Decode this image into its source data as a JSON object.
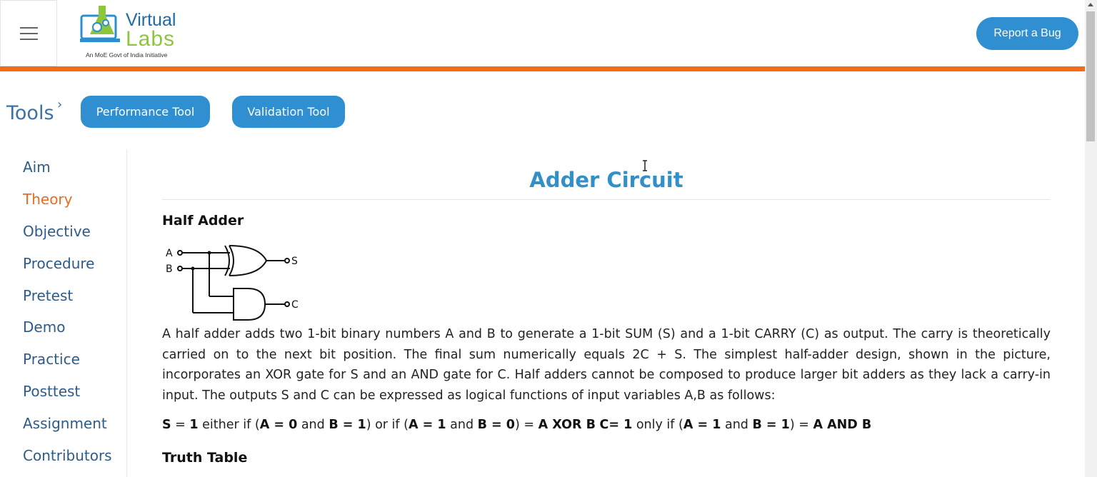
{
  "header": {
    "logo": {
      "title_part1": "Virtual",
      "title_part2": "Labs",
      "tagline": "An MoE Govt of India Initiative"
    },
    "report_bug_label": "Report a Bug"
  },
  "tools": {
    "label": "Tools",
    "buttons": [
      {
        "label": "Performance Tool"
      },
      {
        "label": "Validation Tool"
      }
    ]
  },
  "sidebar": {
    "items": [
      {
        "label": "Aim",
        "active": false
      },
      {
        "label": "Theory",
        "active": true
      },
      {
        "label": "Objective",
        "active": false
      },
      {
        "label": "Procedure",
        "active": false
      },
      {
        "label": "Pretest",
        "active": false
      },
      {
        "label": "Demo",
        "active": false
      },
      {
        "label": "Practice",
        "active": false
      },
      {
        "label": "Posttest",
        "active": false
      },
      {
        "label": "Assignment",
        "active": false
      },
      {
        "label": "Contributors",
        "active": false
      }
    ]
  },
  "main": {
    "title": "Adder Circuit",
    "half_adder_heading": "Half Adder",
    "circuit_labels": {
      "a": "A",
      "b": "B",
      "s": "S",
      "c": "C"
    },
    "paragraph": "A half adder adds two 1-bit binary numbers A and B to generate a 1-bit SUM (S) and a 1-bit CARRY (C) as output. The carry is theoretically carried on to the next bit position. The final sum numerically equals 2C + S. The simplest half-adder design, shown in the picture, incorporates an XOR gate for S and an AND gate for C. Half adders cannot be composed to produce larger bit adders as they lack a carry-in input. The outputs S and C can be expressed as logical functions of input variables A,B as follows:",
    "equation": {
      "s_bold": "S",
      "s_eq": " = ",
      "s_one": "1",
      "either_if": " either if (",
      "a0": "A = 0",
      "and1": " and ",
      "b1": "B = 1",
      "or_if": ") or if (",
      "a1": "A = 1",
      "and2": " and ",
      "b0": "B = 0",
      "close1": ") = ",
      "xor": "A XOR B",
      "space": " ",
      "c_eq": "C= 1",
      "only_if": " only if (",
      "a1b": "A = 1",
      "and3": " and ",
      "b1b": "B = 1",
      "close2": ") = ",
      "and_res": "A AND B"
    },
    "truth_table_heading": "Truth Table"
  },
  "colors": {
    "accent_blue": "#2f8fd0",
    "header_orange": "#f26b16",
    "active_nav": "#ee6a1e",
    "nav_text": "#2d5b8a",
    "title_blue": "#3290c8"
  }
}
